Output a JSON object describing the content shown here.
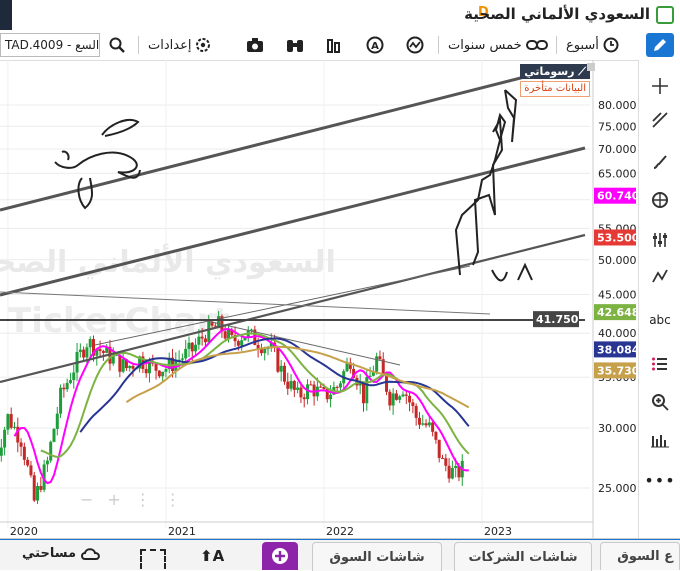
{
  "window": {
    "title": "السعودي الألماني الصحية",
    "badge": "D"
  },
  "toolbar": {
    "symbol": "TAD.4009 - السع",
    "settings_label": "إعدادات",
    "period_label": "خمس سنوات",
    "interval_label": "أسبوع"
  },
  "chart": {
    "watermark_name": "السعودي الألماني الصحية",
    "watermark_brand": "TickerChart",
    "brand_tag": "رسوماتي",
    "delayed_label": "البيانات متأخرة"
  },
  "chart_data": {
    "type": "candlestick",
    "x_ticks": [
      "2020",
      "2021",
      "2022",
      "2023"
    ],
    "y_ticks": [
      "80.000",
      "75.000",
      "70.000",
      "65.000",
      "60.000",
      "55.000",
      "50.000",
      "45.000",
      "40.000",
      "35.000",
      "30.000",
      "25.000"
    ],
    "ylim": [
      23,
      82
    ],
    "y_scale": "log",
    "price_badges": [
      {
        "value": "60.740",
        "color": "#ff00ff"
      },
      {
        "value": "53.500",
        "color": "#e53935"
      },
      {
        "value": "41.750",
        "color": "#454545"
      },
      {
        "value": "42.648",
        "color": "#7cb342"
      },
      {
        "value": "38.084",
        "color": "#283593"
      },
      {
        "value": "35.730",
        "color": "#c6a04a"
      }
    ],
    "close_path": [
      [
        "2019-12",
        27
      ],
      [
        "2020-01",
        31
      ],
      [
        "2020-02",
        29
      ],
      [
        "2020-03",
        24
      ],
      [
        "2020-04",
        27
      ],
      [
        "2020-05",
        33
      ],
      [
        "2020-06",
        36
      ],
      [
        "2020-07",
        39
      ],
      [
        "2020-08",
        38
      ],
      [
        "2020-09",
        37
      ],
      [
        "2020-10",
        36
      ],
      [
        "2020-11",
        37
      ],
      [
        "2020-12",
        36
      ],
      [
        "2021-01",
        36
      ],
      [
        "2021-02",
        37
      ],
      [
        "2021-03",
        38
      ],
      [
        "2021-04",
        40
      ],
      [
        "2021-05",
        41
      ],
      [
        "2021-06",
        39
      ],
      [
        "2021-07",
        40
      ],
      [
        "2021-08",
        39
      ],
      [
        "2021-09",
        38
      ],
      [
        "2021-10",
        35
      ],
      [
        "2021-11",
        33
      ],
      [
        "2021-12",
        34
      ],
      [
        "2022-01",
        33
      ],
      [
        "2022-02",
        34
      ],
      [
        "2022-03",
        37
      ],
      [
        "2022-04",
        33
      ],
      [
        "2022-05",
        37
      ],
      [
        "2022-06",
        33
      ],
      [
        "2022-07",
        34
      ],
      [
        "2022-08",
        31
      ],
      [
        "2022-09",
        30
      ],
      [
        "2022-10",
        27
      ],
      [
        "2022-11",
        26
      ],
      [
        "2022-12",
        27
      ],
      [
        "2023-01",
        34
      ],
      [
        "2023-02",
        37
      ],
      [
        "2023-03",
        46
      ],
      [
        "2023-04",
        62
      ],
      [
        "2023-05",
        70
      ],
      [
        "2023-06",
        65
      ],
      [
        "2023-07",
        58
      ],
      [
        "2023-08",
        53.5
      ]
    ],
    "indicators": [
      {
        "name": "",
        "color": "#ff00ff",
        "last": 60.74
      },
      {
        "name": "",
        "color": "#7cb342",
        "last": 42.648
      },
      {
        "name": "",
        "color": "#283593",
        "last": 38.084
      },
      {
        "name": "",
        "color": "#c6a04a",
        "last": 35.73
      }
    ]
  },
  "bottom": {
    "workspace_label": "مساحتي",
    "font_label": "A",
    "tab_market_1": "شاشات السوق",
    "tab_companies": "شاشات الشركات",
    "tab_market_2": "ع السوق"
  },
  "colors": {
    "accent": "#1976d2",
    "badge": "#f29400"
  }
}
